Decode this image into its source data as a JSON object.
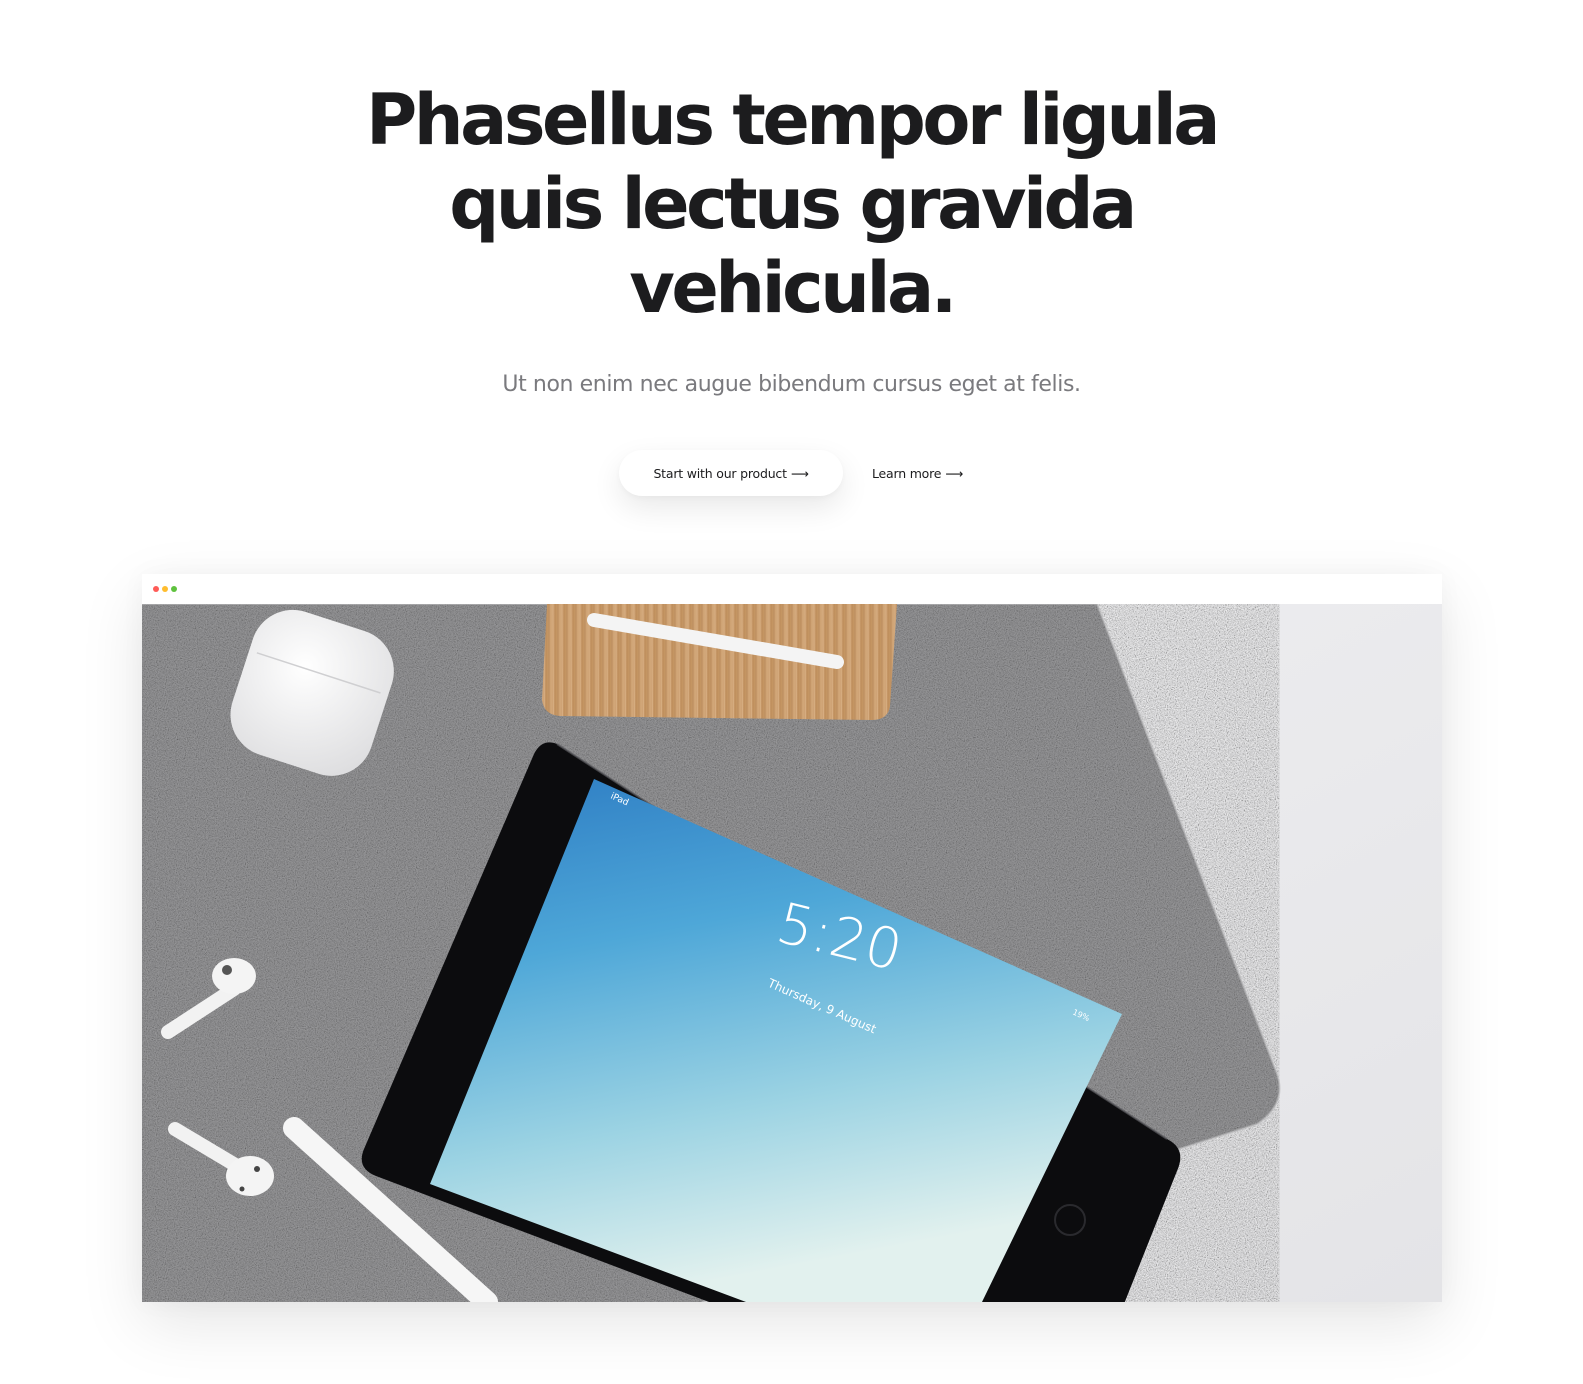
{
  "hero": {
    "title_line_1": "Phasellus tempor ligula",
    "title_line_2": "quis lectus gravida",
    "title_line_3": "vehicula.",
    "subtitle": "Ut non enim nec augue bibendum cursus eget at felis."
  },
  "cta": {
    "primary_label": "Start with our product",
    "secondary_label": "Learn more",
    "arrow": "⟶"
  },
  "browser": {
    "window_controls": [
      {
        "name": "close",
        "color": "#ff5b57"
      },
      {
        "name": "minimize",
        "color": "#ffbd2e"
      },
      {
        "name": "maximize",
        "color": "#5fc23e"
      }
    ]
  },
  "screen": {
    "device_label": "iPad",
    "time": "5:20",
    "date": "Thursday, 9 August",
    "battery": "19%"
  },
  "colors": {
    "text": "#1c1c1e",
    "subtitle": "#7a7a7e",
    "felt": "#9a9a9c",
    "wood": "#c99a6a",
    "screen_top": "#2f7fc4",
    "screen_bottom": "#dcefee"
  }
}
